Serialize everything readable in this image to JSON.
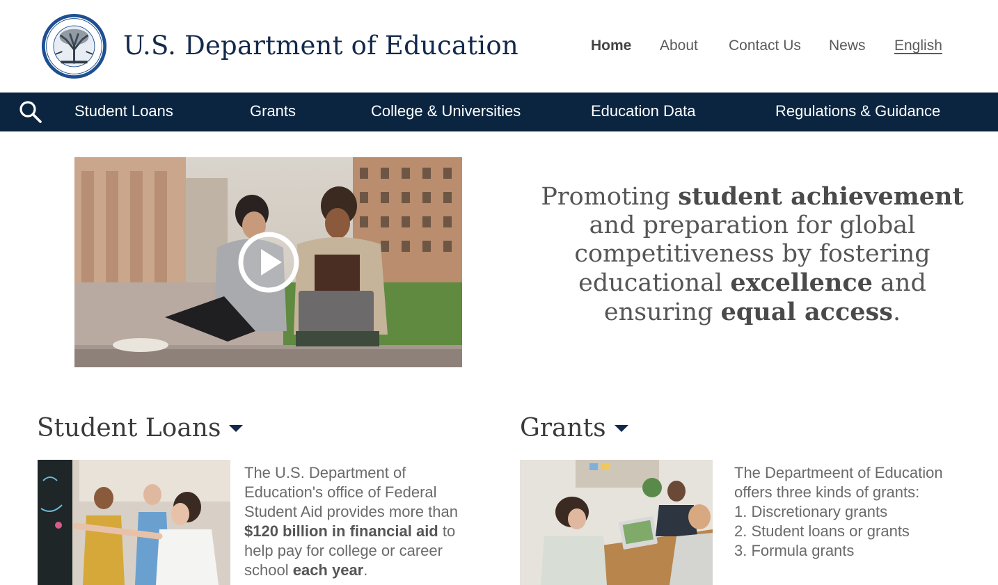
{
  "header": {
    "site_title": "U.S. Department of Education",
    "seal_alt": "Department of Education seal"
  },
  "top_nav": {
    "items": [
      {
        "label": "Home",
        "active": true
      },
      {
        "label": "About",
        "active": false
      },
      {
        "label": "Contact Us",
        "active": false
      },
      {
        "label": "News",
        "active": false
      },
      {
        "label": "English",
        "active": false
      }
    ]
  },
  "main_nav": {
    "search_icon": "search-icon",
    "items": [
      {
        "label": "Student Loans"
      },
      {
        "label": "Grants"
      },
      {
        "label": "College & Universities"
      },
      {
        "label": "Education Data"
      },
      {
        "label": "Regulations & Guidance"
      }
    ]
  },
  "hero": {
    "mission": {
      "p1": "Promoting ",
      "b1": "student achievement",
      "p2": " and preparation for global competitiveness by fostering educational ",
      "b2": "excellence",
      "p3": " and ensuring ",
      "b3": "equal access",
      "p4": "."
    }
  },
  "sections": {
    "student_loans": {
      "title": "Student Loans",
      "line1": "The U.S. Department of",
      "line2": "Education's office of Federal",
      "line3": "Student Aid provides more than",
      "bold1": "$120 billion in financial aid",
      "line4_rest": " to",
      "line5": "help pay for college or career",
      "line6_pre": "school ",
      "bold2": "each year",
      "line6_post": "."
    },
    "grants": {
      "title": "Grants",
      "line1": "The Departmeent of Education",
      "line2": "offers three kinds of grants:",
      "items": [
        "1. Discretionary grants",
        "2. Student loans or grants",
        "3. Formula grants"
      ]
    }
  },
  "colors": {
    "navy": "#0b2541",
    "title_navy": "#13294b"
  }
}
